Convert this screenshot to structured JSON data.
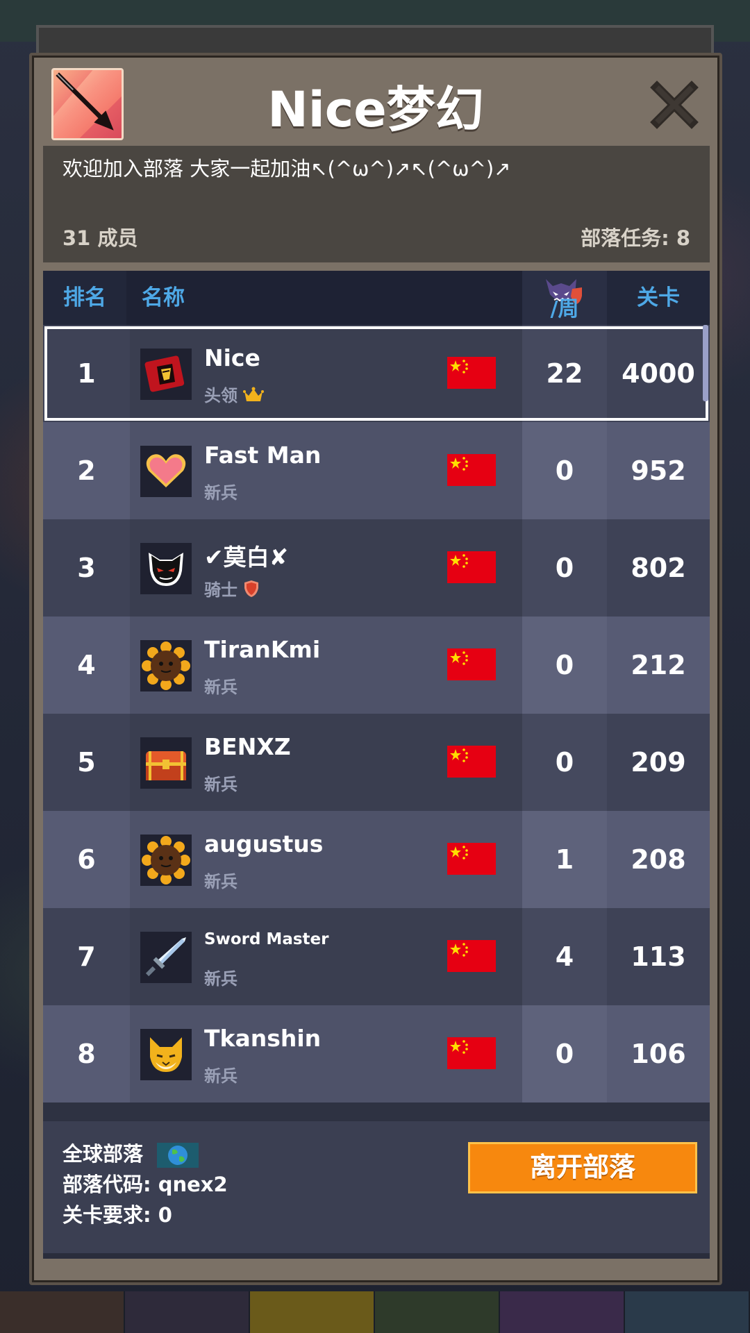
{
  "header": {
    "title": "Nice梦幻",
    "motto": "欢迎加入部落 大家一起加油↖(^ω^)↗↖(^ω^)↗",
    "member_count": "31 成员",
    "clan_tasks": "部落任务: 8"
  },
  "table": {
    "col_rank": "排名",
    "col_name": "名称",
    "col_weekly": "/周",
    "col_level": "关卡",
    "rows": [
      {
        "rank": "1",
        "name": "Nice",
        "role": "头领",
        "weekly": "22",
        "level": "4000",
        "avatar": "clan-emblem-icon",
        "role_icon": "crown-icon",
        "selected": true
      },
      {
        "rank": "2",
        "name": "Fast Man",
        "role": "新兵",
        "weekly": "0",
        "level": "952",
        "avatar": "heart-icon"
      },
      {
        "rank": "3",
        "name": "✔莫白✘",
        "role": "骑士",
        "weekly": "0",
        "level": "802",
        "avatar": "cat-face-icon",
        "role_icon": "shield-icon"
      },
      {
        "rank": "4",
        "name": "TiranKmi",
        "role": "新兵",
        "weekly": "0",
        "level": "212",
        "avatar": "sunflower-icon"
      },
      {
        "rank": "5",
        "name": "BENXZ",
        "role": "新兵",
        "weekly": "0",
        "level": "209",
        "avatar": "treasure-chest-icon"
      },
      {
        "rank": "6",
        "name": "augustus",
        "role": "新兵",
        "weekly": "1",
        "level": "208",
        "avatar": "sunflower-icon"
      },
      {
        "rank": "7",
        "name": "Sword Master",
        "role": "新兵",
        "weekly": "4",
        "level": "113",
        "avatar": "sword-icon"
      },
      {
        "rank": "8",
        "name": "Tkanshin",
        "role": "新兵",
        "weekly": "0",
        "level": "106",
        "avatar": "fox-face-icon"
      }
    ]
  },
  "footer": {
    "global_clan": "全球部落",
    "clan_code": "部落代码: qnex2",
    "level_requirement": "关卡要求:  0",
    "leave_button": "离开部落"
  },
  "colors": {
    "accent_blue": "#4ea8e6",
    "leave_orange": "#f7880e",
    "flag_red": "#e60012",
    "flag_star": "#ffde00"
  }
}
